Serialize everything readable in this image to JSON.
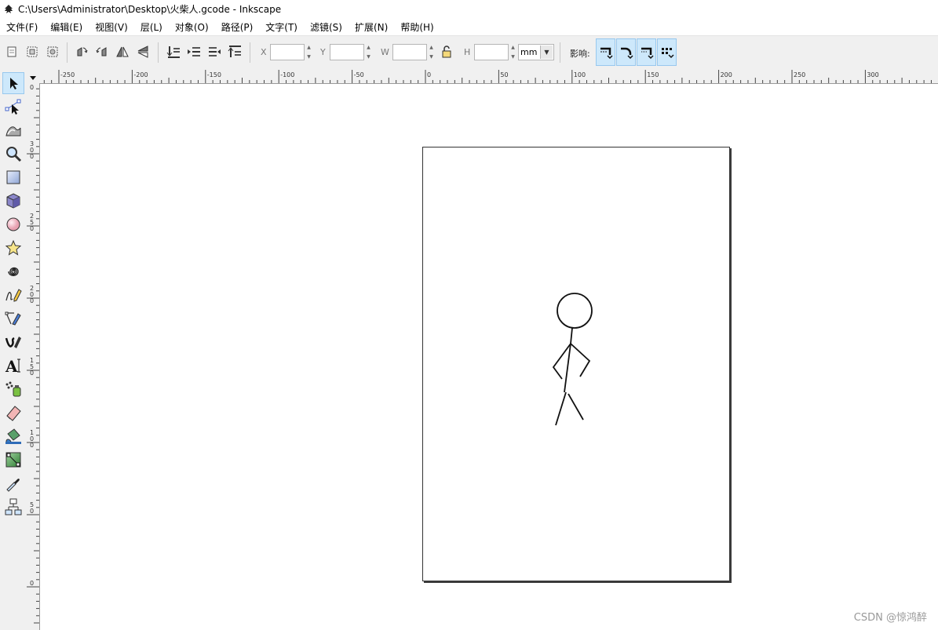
{
  "window": {
    "title": "C:\\Users\\Administrator\\Desktop\\火柴人.gcode - Inkscape"
  },
  "menu": [
    "文件(F)",
    "编辑(E)",
    "视图(V)",
    "层(L)",
    "对象(O)",
    "路径(P)",
    "文字(T)",
    "滤镜(S)",
    "扩展(N)",
    "帮助(H)"
  ],
  "toolbar": {
    "x_label": "X",
    "y_label": "Y",
    "w_label": "W",
    "h_label": "H",
    "x_value": "",
    "y_value": "",
    "w_value": "",
    "h_value": "",
    "unit": "mm",
    "affect_label": "影响:"
  },
  "ruler": {
    "h_labels": [
      "-250",
      "-200",
      "-150",
      "-100",
      "-50",
      "0",
      "50",
      "100",
      "150",
      "200",
      "250",
      "300"
    ],
    "v_labels": [
      "0",
      "300",
      "250",
      "200",
      "150",
      "100",
      "50",
      "0"
    ]
  },
  "watermark": "CSDN @惊鸿醉",
  "colors": {
    "active_blue": "#cde8fb",
    "border_blue": "#98c8ee"
  },
  "icons": {
    "tools": [
      "selector-icon",
      "node-icon",
      "tweak-icon",
      "zoom-icon",
      "rect-icon",
      "3dbox-icon",
      "ellipse-icon",
      "star-icon",
      "spiral-icon",
      "pencil-icon",
      "pen-icon",
      "calligraphy-icon",
      "text-icon",
      "spray-icon",
      "eraser-icon",
      "bucket-icon",
      "gradient-icon",
      "dropper-icon",
      "connector-icon"
    ]
  }
}
